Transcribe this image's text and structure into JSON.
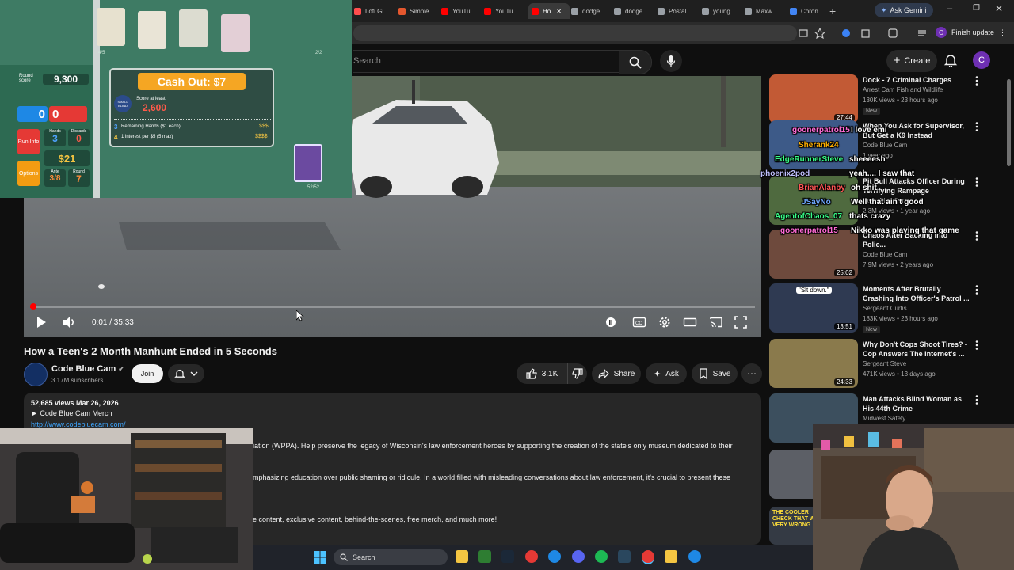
{
  "browser": {
    "tabs": [
      {
        "label": "Lofi Gi",
        "color": "#ff4d4d"
      },
      {
        "label": "Simple",
        "color": "#e4572e"
      },
      {
        "label": "YouTu",
        "color": "#ff0000"
      },
      {
        "label": "YouTu",
        "color": "#ff0000"
      },
      {
        "label": "Ho",
        "color": "#ff0000"
      },
      {
        "label": "dodge",
        "color": "#9aa0a6"
      },
      {
        "label": "dodge",
        "color": "#9aa0a6"
      },
      {
        "label": "Postal",
        "color": "#9aa0a6"
      },
      {
        "label": "young",
        "color": "#9aa0a6"
      },
      {
        "label": "Maxw",
        "color": "#9aa0a6"
      },
      {
        "label": "Coron",
        "color": "#4285f4"
      }
    ],
    "ask_gemini": "Ask Gemini",
    "finish_update": "Finish update",
    "profile_initial": "C"
  },
  "header": {
    "search_placeholder": "Search",
    "create_label": "Create",
    "avatar_initial": "C"
  },
  "player": {
    "time": "0:01 / 35:33",
    "progress_fraction": 0.003
  },
  "video": {
    "title": "How a Teen's 2 Month Manhunt Ended in 5 Seconds",
    "channel": "Code Blue Cam",
    "subscribers": "3.17M subscribers",
    "join": "Join",
    "likes": "3.1K",
    "share": "Share",
    "ask": "Ask",
    "save": "Save"
  },
  "description": {
    "views_date": "52,685 views  Mar 26, 2026",
    "merch": "► Code Blue Cam Merch",
    "link": "http://www.codebluecam.com/",
    "line1": "iation (WPPA). Help preserve the legacy of Wisconsin's law enforcement heroes by supporting the creation of the state's only museum dedicated to their",
    "line2": "mphasizing education over public shaming or ridicule. In a world filled with misleading conversations about law enforcement, it's crucial to present these",
    "line3": "e content, exclusive content, behind-the-scenes, free merch, and much more!"
  },
  "sidebar": {
    "items": [
      {
        "title": "Dock - 7 Criminal Charges",
        "channel": "Arrest Cam Fish and Wildlife",
        "views": "130K views • 23 hours ago",
        "duration": "27:44",
        "badge": "New",
        "thumb_color": "#c25a35"
      },
      {
        "title": "When You Ask for Supervisor, But Get a K9 Instead",
        "channel": "Code Blue Cam",
        "views": "1 year ago",
        "duration": "",
        "badge": "",
        "thumb_color": "#3d5a88"
      },
      {
        "title": "Pit Bull Attacks Officer During Terrifying Rampage",
        "channel": "Code Blue Cam",
        "views": "2.3M views • 1 year ago",
        "duration": "",
        "badge": "",
        "thumb_color": "#4f6a3f"
      },
      {
        "title": "Chaos After Backing into Polic...",
        "channel": "Code Blue Cam",
        "views": "7.9M views • 2 years ago",
        "duration": "25:02",
        "badge": "",
        "thumb_color": "#6e4a3d"
      },
      {
        "title": "Moments After Brutally Crashing Into Officer's Patrol ...",
        "channel": "Sergeant Curtis",
        "views": "183K views • 23 hours ago",
        "duration": "13:51",
        "badge": "New",
        "thumb_color": "#2f3a52",
        "thumb_text": "\"Slt down.\""
      },
      {
        "title": "Why Don't Cops Shoot Tires? - Cop Answers The Internet's ...",
        "channel": "Sergeant Steve",
        "views": "471K views • 13 days ago",
        "duration": "24:33",
        "badge": "",
        "thumb_color": "#8a7a4c"
      },
      {
        "title": "Man Attacks Blind Woman as His 44th Crime",
        "channel": "Midwest Safety",
        "views": "",
        "duration": "",
        "badge": "",
        "thumb_color": "#3c4f5e"
      }
    ],
    "extra_thumb_1": "#5c5f66",
    "extra_thumb_2_text": "THE COOLER CHECK THAT WENT VERY WRONG"
  },
  "chat": [
    {
      "user": "goonerpatrol15",
      "user_color": "#ff6ad5",
      "message": "I love emi"
    },
    {
      "user": "Sherank24",
      "user_color": "#ffb000",
      "message": ""
    },
    {
      "user": "EdgeRunnerSteve",
      "user_color": "#39ff88",
      "message": "sheeeesh"
    },
    {
      "user": "phoenix2pod",
      "user_color": "#c0c0ff",
      "message": "yeah.... I saw that"
    },
    {
      "user": "BrianAlanby",
      "user_color": "#ff5555",
      "message": "oh shit"
    },
    {
      "user": "JSayNo",
      "user_color": "#6fa8ff",
      "message": "Well that ain't good"
    },
    {
      "user": "AgentofChaos_07",
      "user_color": "#39ff88",
      "message": "thats crazy"
    },
    {
      "user": "goonerpatrol15",
      "user_color": "#ff6ad5",
      "message": "Nikko was playing that game"
    }
  ],
  "game": {
    "cash_out": "Cash Out: $7",
    "round_score_label": "Round score",
    "round_score": "9,300",
    "chips": "0",
    "mult": "0",
    "run_info": "Run Info",
    "hands_label": "Hands",
    "hands": "3",
    "discards_label": "Discards",
    "discards": "0",
    "money": "$21",
    "options": "Options",
    "ante_label": "Ante",
    "ante": "3/8",
    "round_label": "Round",
    "round": "7",
    "score_at_least_label": "Score at least",
    "blind_name": "SMALL BLIND",
    "score_at_least": "2,600",
    "remaining_hands_text": "Remaining Hands ($1 each)",
    "remaining_hands_n": "3",
    "remaining_hands_money": "$$$",
    "interest_text": "1 interest per $5 (5 max)",
    "interest_n": "4",
    "interest_money": "$$$$",
    "joker_count": "4/5",
    "consumable_count": "2/2",
    "deck_count": "52/52"
  },
  "taskbar": {
    "search": "Search"
  }
}
